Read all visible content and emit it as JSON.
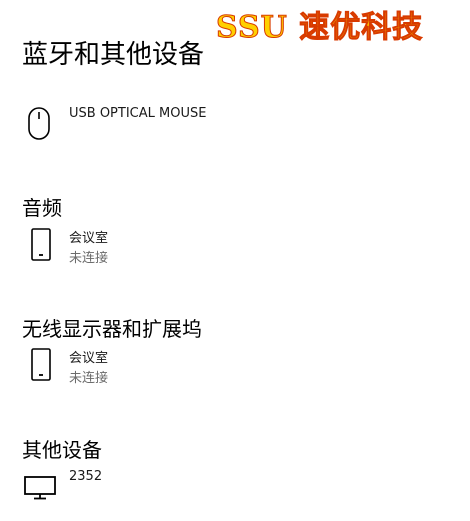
{
  "watermark": "SSU 速优科技",
  "page": {
    "title": "蓝牙和其他设备"
  },
  "mouse_section": {
    "device": {
      "name": "USB OPTICAL MOUSE",
      "icon": "mouse-icon"
    }
  },
  "audio_section": {
    "heading": "音频",
    "device": {
      "name": "会议室",
      "status": "未连接",
      "icon": "phone-icon"
    }
  },
  "wireless_display_section": {
    "heading": "无线显示器和扩展坞",
    "device": {
      "name": "会议室",
      "status": "未连接",
      "icon": "phone-icon"
    }
  },
  "other_devices_section": {
    "heading": "其他设备",
    "device": {
      "name": "2352",
      "icon": "monitor-icon"
    }
  },
  "colors": {
    "text": "#000000",
    "secondary_text": "#6b6b6b",
    "watermark_fill": "#ffd000",
    "watermark_stroke": "#d83a00"
  }
}
